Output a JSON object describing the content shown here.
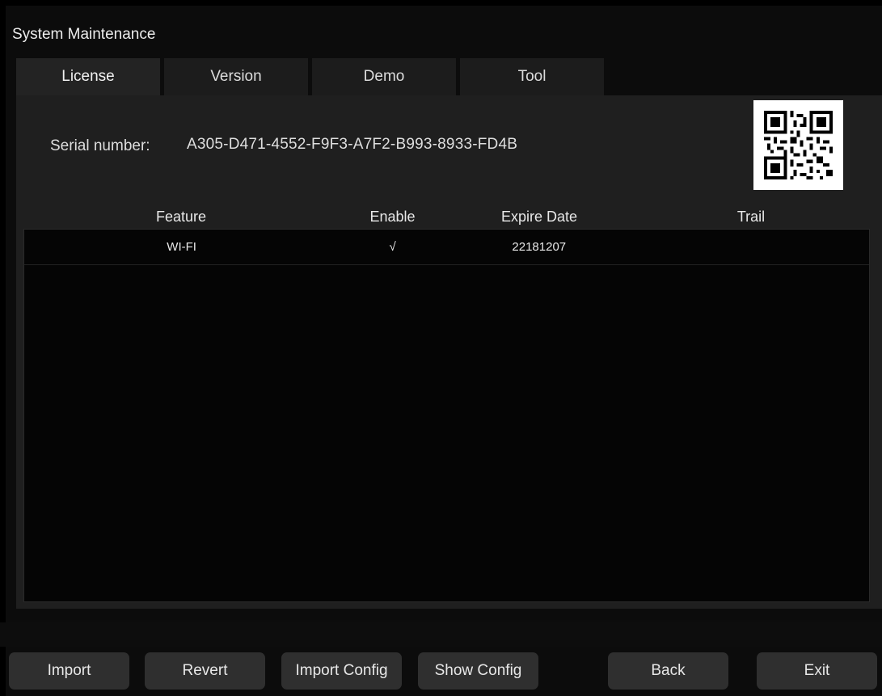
{
  "window": {
    "title": "System Maintenance"
  },
  "tabs": [
    {
      "label": "License",
      "active": true
    },
    {
      "label": "Version",
      "active": false
    },
    {
      "label": "Demo",
      "active": false
    },
    {
      "label": "Tool",
      "active": false
    }
  ],
  "license": {
    "serial_label": "Serial number:",
    "serial_value": "A305-D471-4552-F9F3-A7F2-B993-8933-FD4B",
    "qr_icon": "qr-code-icon",
    "table": {
      "headers": [
        "Feature",
        "Enable",
        "Expire Date",
        "Trail"
      ],
      "rows": [
        {
          "feature": "WI-FI",
          "enable": "√",
          "expire": "22181207",
          "trail": ""
        }
      ]
    }
  },
  "buttons": {
    "import": "Import",
    "revert": "Revert",
    "import_config": "Import Config",
    "show_config": "Show Config",
    "back": "Back",
    "exit": "Exit"
  },
  "colors": {
    "background": "#000000",
    "panel": "#1f1f1f",
    "button": "#2f2f2f",
    "text": "#e6e6e6"
  }
}
